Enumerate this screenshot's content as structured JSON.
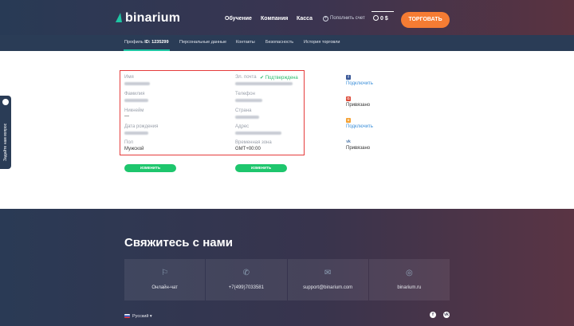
{
  "header": {
    "logo": "binarium",
    "nav": [
      "Обучение",
      "Компания",
      "Касса"
    ],
    "deposit": "Пополнить счет",
    "balance": "0 $",
    "trade_button": "ТОРГОВАТЬ"
  },
  "subnav": {
    "profile_prefix": "Профиль ",
    "profile_id": "ID: 1235299",
    "items": [
      "Персональные данные",
      "Контакты",
      "Безопасность",
      "История торговли"
    ]
  },
  "form": {
    "name_label": "Имя",
    "surname_label": "Фамилия",
    "nickname_label": "Никнейм",
    "nickname_value": "—",
    "birthdate_label": "Дата рождения",
    "gender_label": "Пол",
    "gender_value": "Мужской",
    "email_label": "Эл. почта",
    "email_status": "✔ Подтверждена",
    "phone_label": "Телефон",
    "country_label": "Страна",
    "address_label": "Адрес",
    "timezone_label": "Временная зона",
    "timezone_value": "GMT+00:00",
    "edit_label": "ИЗМЕНИТЬ"
  },
  "social": [
    {
      "icon": "facebook-icon",
      "status": "Подключить",
      "color": "#3b5998",
      "glyph": "f"
    },
    {
      "icon": "google-plus-icon",
      "status": "Привязано",
      "color": "#dd4b39",
      "glyph": "G"
    },
    {
      "icon": "odnoklassniki-icon",
      "status": "Подключить",
      "color": "#f4a134",
      "glyph": "ok"
    },
    {
      "icon": "vk-icon",
      "status": "Привязано",
      "color": "#4a76a8",
      "glyph": "vk"
    }
  ],
  "side_tab": "Задайте нам вопрос",
  "footer": {
    "title": "Свяжитесь с нами",
    "contacts": [
      {
        "icon": "chat-icon",
        "text": "Онлайн-чат"
      },
      {
        "icon": "phone-icon",
        "text": "+7(499)7033581"
      },
      {
        "icon": "mail-icon",
        "text": "support@binarium.com"
      },
      {
        "icon": "globe-icon",
        "text": "binarium.ru"
      }
    ],
    "language": "Русский ▾"
  },
  "colors": {
    "accent": "#f57c33",
    "green": "#1ec66d",
    "link": "#3b8fd9",
    "highlight_border": "#e53b3b"
  }
}
